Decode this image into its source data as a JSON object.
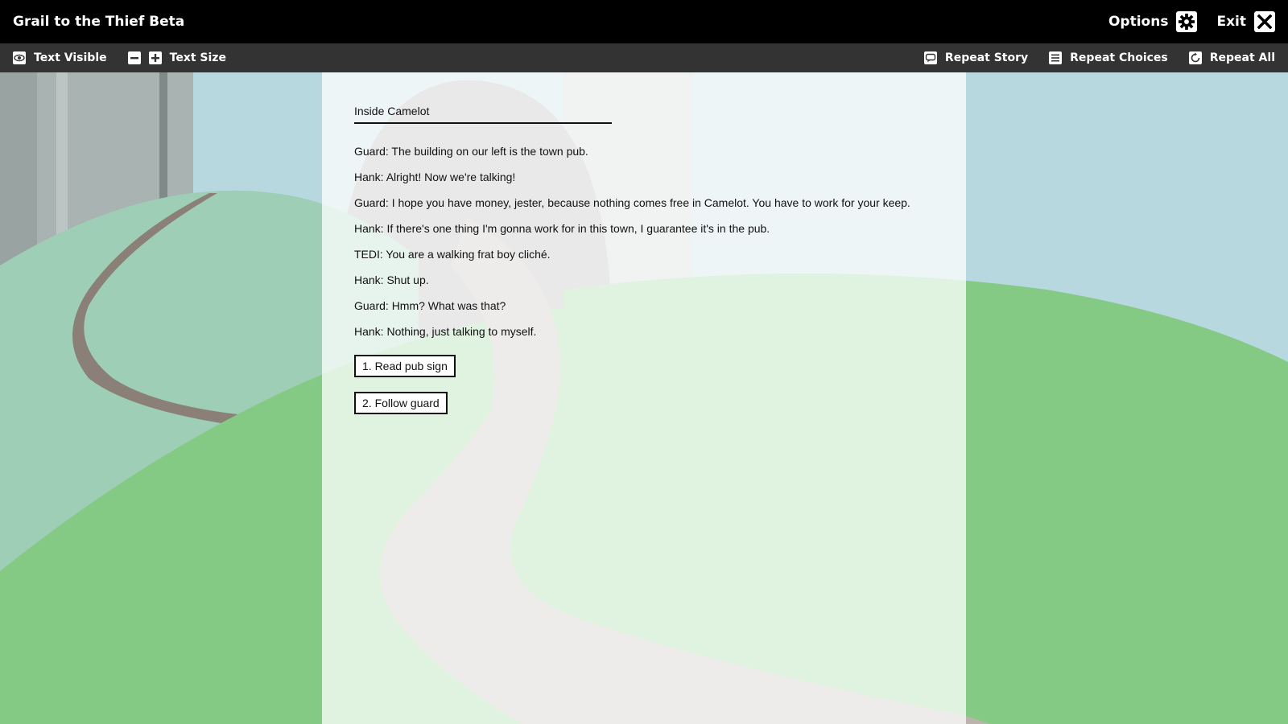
{
  "app": {
    "title": "Grail to the Thief Beta",
    "options_label": "Options",
    "exit_label": "Exit"
  },
  "toolbar": {
    "text_visible_label": "Text Visible",
    "text_size_label": "Text Size",
    "repeat_story_label": "Repeat Story",
    "repeat_choices_label": "Repeat Choices",
    "repeat_all_label": "Repeat All"
  },
  "story": {
    "scene_title": "Inside Camelot",
    "lines": [
      "Guard: The building on our left is the town pub.",
      "Hank: Alright! Now we're talking!",
      "Guard: I hope you have money, jester, because nothing comes free in Camelot. You have to work for your keep.",
      "Hank: If there's one thing I'm gonna work for in this town, I guarantee it's in the pub.",
      "TEDI: You are a walking frat boy cliché.",
      "Hank: Shut up.",
      "Guard: Hmm? What was that?",
      "Hank: Nothing, just talking to myself."
    ],
    "choices": [
      "1. Read pub sign",
      "2. Follow guard"
    ]
  },
  "colors": {
    "sky": "#b7d8df",
    "hill_light": "#9fceb6",
    "hill_green": "#84c984",
    "road": "#8a8078",
    "building": "#a8b0b0"
  },
  "icons": {
    "options": "gear-icon",
    "exit": "close-icon",
    "text_visible": "eye-icon",
    "text_size_decrease": "minus-icon",
    "text_size_increase": "plus-icon",
    "repeat_story": "speech-bubble-icon",
    "repeat_choices": "list-icon",
    "repeat_all": "replay-icon"
  }
}
